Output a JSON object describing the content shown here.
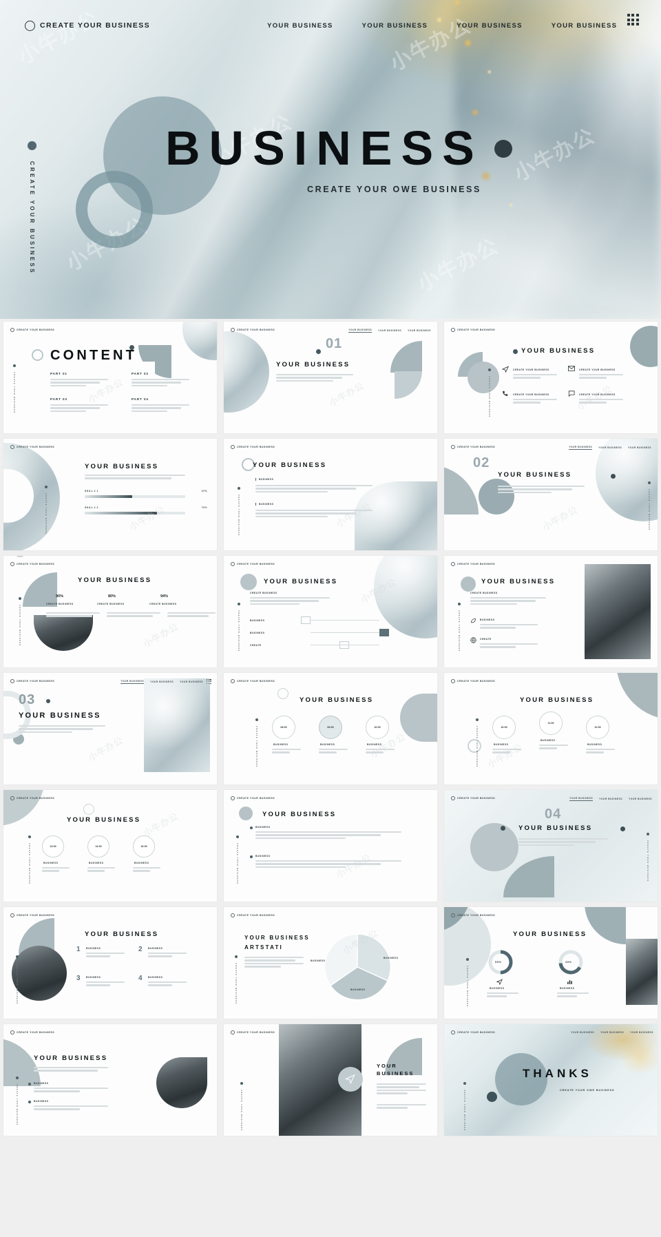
{
  "hero": {
    "brand": "CREATE YOUR BUSINESS",
    "nav": [
      "YOUR BUSINESS",
      "YOUR BUSINESS",
      "YOUR BUSINESS",
      "YOUR BUSINESS"
    ],
    "title": "BUSINESS",
    "subtitle": "CREATE YOUR OWE BUSINESS",
    "vertical": "CREATE YOUR BUSINESS",
    "watermark": "小牛办公",
    "menu_icon": "grid-menu-icon"
  },
  "colors": {
    "accent": "#53686f",
    "dark": "#2f3d43",
    "muted": "#9aa9ae",
    "bar_fill": "#37474d",
    "slide_bg": "#fdfdfd",
    "page_bg": "#efefef"
  },
  "common": {
    "brand": "CREATE YOUR BUSINESS",
    "vertical": "CREATE YOUR BUSINESS",
    "nav_item": "YOUR BUSINESS",
    "title": "YOUR BUSINESS",
    "lorem": "这里输入正文这里输入正文这里输入正文",
    "lorem_short": "这里输入正文这里输入正文"
  },
  "slides": [
    {
      "id": 1,
      "name": "content-slide",
      "title": "CONTENT",
      "parts": [
        {
          "label": "PART 01",
          "text": "这里输入正文这里输入正文这里输入正文\n这里输入正文这里输入正文"
        },
        {
          "label": "PART 02",
          "text": "这里输入正文这里输入正文这里输入正文\n这里输入正文这里输入正文"
        },
        {
          "label": "PART 03",
          "text": "这里输入正文这里输入正文这里输入正文\n这里输入正文这里输入正文"
        },
        {
          "label": "PART 04",
          "text": "这里输入正文这里输入正文这里输入正文\n这里输入正文这里输入正文"
        }
      ]
    },
    {
      "id": 2,
      "name": "section-divider-01",
      "number": "01",
      "title": "YOUR BUSINESS"
    },
    {
      "id": 3,
      "name": "feature-icons-slide",
      "title": "YOUR BUSINESS",
      "features": [
        {
          "icon": "paper-plane-icon",
          "label": "CREATE YOUR BUSINESS"
        },
        {
          "icon": "envelope-icon",
          "label": "CREATE YOUR BUSINESS"
        },
        {
          "icon": "phone-icon",
          "label": "CREATE YOUR BUSINESS"
        },
        {
          "icon": "chat-icon",
          "label": "CREATE YOUR BUSINESS"
        }
      ]
    },
    {
      "id": 4,
      "name": "skill-bars-slide",
      "title": "YOUR BUSINESS",
      "bars": [
        {
          "label": "SKILL # 1",
          "value": "47%",
          "pct": 47
        },
        {
          "label": "SKILL # 2",
          "value": "72%",
          "pct": 72
        }
      ]
    },
    {
      "id": 5,
      "name": "two-column-text-slide",
      "title": "YOUR BUSINESS",
      "blocks": [
        "BUSINESS",
        "BUSINESS"
      ]
    },
    {
      "id": 6,
      "name": "section-divider-02",
      "number": "02",
      "title": "YOUR BUSINESS"
    },
    {
      "id": 7,
      "name": "percent-stats-slide",
      "title": "YOUR BUSINESS",
      "stats": [
        {
          "value": "90%",
          "label": "CREATE BUSINESS"
        },
        {
          "value": "80%",
          "label": "CREATE BUSINESS"
        },
        {
          "value": "94%",
          "label": "CREATE BUSINESS"
        }
      ]
    },
    {
      "id": 8,
      "name": "process-diagram-slide",
      "title": "YOUR BUSINESS",
      "kicker": "CREATE BUSINESS",
      "rows": [
        "BUSINESS",
        "BUSINESS",
        "CREATE"
      ]
    },
    {
      "id": 9,
      "name": "image-feature-slide",
      "title": "YOUR BUSINESS",
      "kicker": "CREATE BUSINESS",
      "items": [
        {
          "icon": "leaf-icon",
          "label": "BUSINESS"
        },
        {
          "icon": "globe-icon",
          "label": "CREATE"
        }
      ]
    },
    {
      "id": 10,
      "name": "section-divider-03",
      "number": "03",
      "title": "YOUR BUSINESS"
    },
    {
      "id": 11,
      "name": "timeline-circles-slide-a",
      "title": "YOUR BUSINESS",
      "steps": [
        {
          "time": "08:00",
          "label": "BUSINESS"
        },
        {
          "time": "09:00",
          "label": "BUSINESS"
        },
        {
          "time": "10:00",
          "label": "BUSINESS"
        }
      ]
    },
    {
      "id": 12,
      "name": "timeline-circles-slide-b",
      "title": "YOUR BUSINESS",
      "steps": [
        {
          "time": "10:00",
          "label": "BUSINESS"
        },
        {
          "time": "11:00",
          "label": "BUSINESS"
        },
        {
          "time": "12:00",
          "label": "BUSINESS"
        }
      ]
    },
    {
      "id": 13,
      "name": "timeline-circles-slide-c",
      "title": "YOUR BUSINESS",
      "steps": [
        {
          "time": "13:00",
          "label": "BUSINESS"
        },
        {
          "time": "14:00",
          "label": "BUSINESS"
        },
        {
          "time": "16:00",
          "label": "BUSINESS"
        }
      ]
    },
    {
      "id": 14,
      "name": "bullet-list-slide",
      "title": "YOUR BUSINESS",
      "bullets": [
        "BUSINESS",
        "BUSINESS"
      ]
    },
    {
      "id": 15,
      "name": "section-divider-04",
      "number": "04",
      "title": "YOUR BUSINESS"
    },
    {
      "id": 16,
      "name": "numbered-list-slide",
      "title": "YOUR BUSINESS",
      "items": [
        {
          "num": "1",
          "label": "BUSINESS"
        },
        {
          "num": "2",
          "label": "BUSINESS"
        },
        {
          "num": "3",
          "label": "BUSINESS"
        },
        {
          "num": "4",
          "label": "BUSINESS"
        }
      ]
    },
    {
      "id": 17,
      "name": "pie-chart-slide",
      "title": "YOUR  BUSINESS",
      "subtitle": "ARTSTATI",
      "slices": [
        {
          "label": "BUSINESS",
          "value": 38
        },
        {
          "label": "BUSINESS",
          "value": 34
        },
        {
          "label": "BUSINESS",
          "value": 28
        }
      ]
    },
    {
      "id": 18,
      "name": "donut-stats-slide",
      "title": "YOUR BUSINESS",
      "donuts": [
        {
          "value": "50%",
          "pct": 50,
          "icon": "paper-plane-icon",
          "label": "BUSINESS"
        },
        {
          "value": "40%",
          "pct": 40,
          "icon": "chart-icon",
          "label": "BUSINESS"
        }
      ]
    },
    {
      "id": 19,
      "name": "bullet-photo-slide",
      "title": "YOUR BUSINESS",
      "bullets": [
        "BUSINESS",
        "BUSINESS"
      ]
    },
    {
      "id": 20,
      "name": "photo-split-slide",
      "title": "YOUR\nBUSINESS",
      "badge_icon": "paper-plane-icon"
    },
    {
      "id": 21,
      "name": "thanks-slide",
      "title": "THANKS",
      "subtitle": "CREATE YOUR OWE BUSINESS",
      "nav": [
        "YOUR BUSINESS",
        "YOUR BUSINESS",
        "YOUR BUSINESS"
      ]
    }
  ],
  "chart_data": [
    {
      "type": "bar",
      "title": "Skill bars",
      "categories": [
        "SKILL # 1",
        "SKILL # 2"
      ],
      "values": [
        47,
        72
      ],
      "xlabel": "",
      "ylabel": "",
      "ylim": [
        0,
        100
      ]
    },
    {
      "type": "bar",
      "title": "Percent stats",
      "categories": [
        "CREATE BUSINESS",
        "CREATE BUSINESS",
        "CREATE BUSINESS"
      ],
      "values": [
        90,
        80,
        94
      ],
      "xlabel": "",
      "ylabel": "",
      "ylim": [
        0,
        100
      ]
    },
    {
      "type": "pie",
      "title": "YOUR  BUSINESS ARTSTATI",
      "categories": [
        "BUSINESS",
        "BUSINESS",
        "BUSINESS"
      ],
      "values": [
        38,
        34,
        28
      ]
    },
    {
      "type": "pie",
      "title": "Donut stats",
      "categories": [
        "BUSINESS",
        "BUSINESS"
      ],
      "values": [
        50,
        40
      ]
    }
  ]
}
